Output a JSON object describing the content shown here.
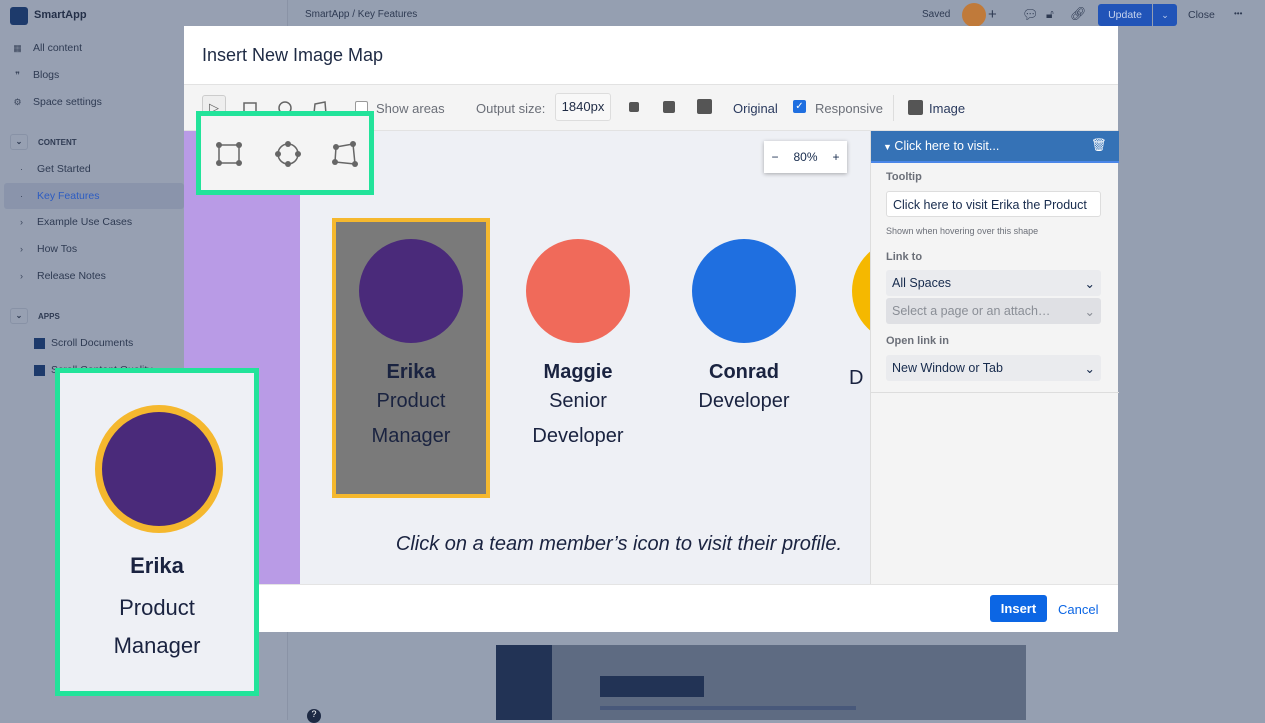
{
  "app": {
    "name": "SmartApp"
  },
  "sidebar": {
    "items": [
      {
        "label": "All content",
        "icon": "grid-icon"
      },
      {
        "label": "Blogs",
        "icon": "quote-icon"
      },
      {
        "label": "Space settings",
        "icon": "gear-icon"
      }
    ],
    "content_header": "CONTENT",
    "content_items": [
      {
        "label": "Get Started"
      },
      {
        "label": "Key Features"
      },
      {
        "label": "Example Use Cases"
      },
      {
        "label": "How Tos"
      },
      {
        "label": "Release Notes"
      }
    ],
    "apps_header": "APPS",
    "apps": [
      {
        "label": "Scroll Documents"
      },
      {
        "label": "Scroll Content Quality"
      }
    ]
  },
  "topbar": {
    "breadcrumb": "SmartApp  /  Key Features",
    "saved": "Saved",
    "update": "Update",
    "close": "Close",
    "more": "•••"
  },
  "modal": {
    "title": "Insert New Image Map",
    "toolbar": {
      "show_areas": "Show areas",
      "output_size_label": "Output size:",
      "output_size": "1840px",
      "original": "Original",
      "responsive": "Responsive",
      "responsive_checked": true,
      "image": "Image"
    },
    "zoom": {
      "minus": "−",
      "value": "80%",
      "plus": "+"
    },
    "people": [
      {
        "name": "Erika",
        "role": "Product Manager",
        "color": "#4a2a7a"
      },
      {
        "name": "Maggie",
        "role": "Senior Developer",
        "color": "#f06a5a"
      },
      {
        "name": "Conrad",
        "role": "Developer",
        "color": "#1f6fe0"
      },
      {
        "name": "",
        "role": "D",
        "color": "#f5b800"
      }
    ],
    "caption": "Click on a team member’s icon to visit their profile.",
    "panel": {
      "header": "Click here to visit...",
      "tooltip_label": "Tooltip",
      "tooltip_value": "Click here to visit Erika the Product",
      "tooltip_help": "Shown when hovering over this shape",
      "link_label": "Link to",
      "link_space": "All Spaces",
      "link_placeholder": "Select a page or an attach…",
      "open_label": "Open link in",
      "open_value": "New Window or Tab"
    },
    "insert": "Insert",
    "cancel": "Cancel"
  },
  "callout": {
    "name": "Erika",
    "role": "Product Manager"
  },
  "colors": {
    "accent": "#0c66e4",
    "highlight": "#22e39a",
    "selection": "#f5b82e"
  }
}
